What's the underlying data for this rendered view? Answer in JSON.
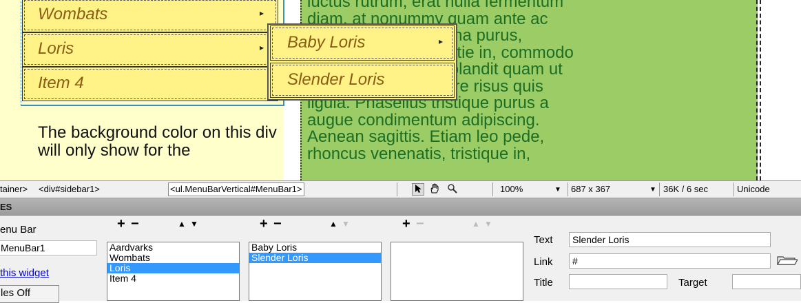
{
  "design": {
    "menu_items": [
      "Wombats",
      "Loris",
      "Item 4"
    ],
    "submenu_items": [
      "Baby Loris",
      "Slender Loris"
    ],
    "sidebar_text": "The background color on this div will only show for the",
    "content_lines": [
      "luctus rutrum, erat nulla fermentum",
      "diam, at nonummy quam ante ac",
      "quam. Maecenas urna purus,",
      "fermentum id, molestie in, commodo",
      "porttitor, felis. Nam blandit quam ut",
      "lacus. Quisque ornare risus quis",
      "ligula. Phasellus tristique purus a",
      "augue condimentum adipiscing.",
      "Aenean sagittis. Etiam leo pede,",
      "rhoncus venenatis, tristique in,"
    ],
    "arrow": "▸"
  },
  "statusbar": {
    "tag_container": "tainer>",
    "tag_sidebar": "<div#sidebar1>",
    "tag_selected": "<ul.MenuBarVertical#MenuBar1>",
    "zoom": "100%",
    "size": "687 x 367",
    "download": "36K / 6 sec",
    "encoding": "Unicode"
  },
  "panel": {
    "title": "ES",
    "widget_type": "enu Bar",
    "widget_id": "MenuBar1",
    "customize_link": "this widget",
    "styles_button": "les Off",
    "col1_items": [
      "Aardvarks",
      "Wombats",
      "Loris",
      "Item 4"
    ],
    "col1_selected": 2,
    "col2_items": [
      "Baby Loris",
      "Slender Loris"
    ],
    "col2_selected": 1,
    "col3_items": [],
    "text_label": "Text",
    "text_value": "Slender Loris",
    "link_label": "Link",
    "link_value": "#",
    "title_label": "Title",
    "title_value": "",
    "target_label": "Target",
    "target_value": "",
    "plus": "+",
    "minus": "−",
    "up": "▲",
    "down": "▼"
  },
  "colors": {
    "menu_bg": "#fff287",
    "sidebar_bg": "#ffffcc",
    "content_bg": "#9ccc66",
    "content_text": "#1c6e25",
    "selection": "#3399ff"
  },
  "icons": [
    "pointer-icon",
    "hand-icon",
    "zoom-icon",
    "folder-icon"
  ]
}
